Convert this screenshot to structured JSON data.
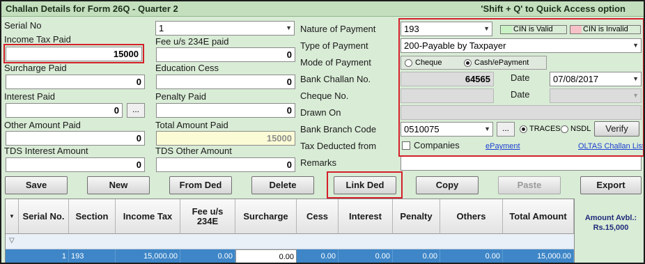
{
  "window": {
    "title": "Challan Details for Form 26Q - Quarter 2",
    "shortcut_hint": "'Shift + Q' to Quick Access option"
  },
  "left_form": {
    "serial_no_label": "Serial No",
    "serial_no_value": "1",
    "income_tax_label": "Income Tax Paid",
    "income_tax_value": "15000",
    "fee_label": "Fee u/s 234E paid",
    "fee_value": "0",
    "surcharge_label": "Surcharge Paid",
    "surcharge_value": "0",
    "education_cess_label": "Education Cess",
    "education_cess_value": "0",
    "interest_label": "Interest Paid",
    "interest_value": "0",
    "penalty_label": "Penalty Paid",
    "penalty_value": "0",
    "other_amount_label": "Other Amount Paid",
    "other_amount_value": "0",
    "total_amount_label": "Total Amount Paid",
    "total_amount_value": "15000",
    "tds_interest_label": "TDS Interest Amount",
    "tds_interest_value": "0",
    "tds_other_label": "TDS Other Amount",
    "tds_other_value": "0",
    "ellipsis": "..."
  },
  "right_form": {
    "nature_label": "Nature of Payment",
    "nature_value": "193",
    "type_label": "Type of Payment",
    "type_value": "200-Payable by Taxpayer",
    "mode_label": "Mode of Payment",
    "mode_cheque": "Cheque",
    "mode_cash": "Cash/ePayment",
    "bank_challan_label": "Bank Challan No.",
    "bank_challan_value": "64565",
    "date_label": "Date",
    "date_value": "07/08/2017",
    "cheque_label": "Cheque No.",
    "cheque_value": "",
    "date2_label": "Date",
    "date2_value": "",
    "drawn_on_label": "Drawn On",
    "drawn_on_value": "",
    "branch_label": "Bank Branch Code",
    "branch_value": "0510075",
    "traces_label": "TRACES",
    "nsdl_label": "NSDL",
    "verify_label": "Verify",
    "tax_deducted_label": "Tax Deducted from",
    "companies_label": "Companies",
    "epayment_link": "ePayment",
    "oltas_link": "OLTAS Challan List",
    "remarks_label": "Remarks",
    "remarks_value": "",
    "cin_valid": "CIN is Valid",
    "cin_invalid": "CIN is Invalid",
    "ellipsis": "..."
  },
  "colors": {
    "cin_valid": "#c9f2c4",
    "cin_invalid": "#f6c2c7",
    "highlight_box": "#d4202a",
    "selected_row": "#3e86c7"
  },
  "toolbar": {
    "save": "Save",
    "new": "New",
    "from_ded": "From Ded",
    "delete": "Delete",
    "link_ded": "Link Ded",
    "copy": "Copy",
    "paste": "Paste",
    "export": "Export"
  },
  "grid": {
    "headers": {
      "serial": "Serial No.",
      "section": "Section",
      "income_tax": "Income Tax",
      "fee": "Fee u/s 234E",
      "surcharge": "Surcharge",
      "cess": "Cess",
      "interest": "Interest",
      "penalty": "Penalty",
      "others": "Others",
      "total": "Total Amount"
    },
    "row": {
      "serial": "1",
      "section": "193",
      "income_tax": "15,000.00",
      "fee": "0.00",
      "surcharge": "0.00",
      "cess": "0.00",
      "interest": "0.00",
      "penalty": "0.00",
      "others": "0.00",
      "total": "15,000.00"
    }
  },
  "amount_available": {
    "label": "Amount Avbl.:",
    "value": "Rs.15,000"
  }
}
